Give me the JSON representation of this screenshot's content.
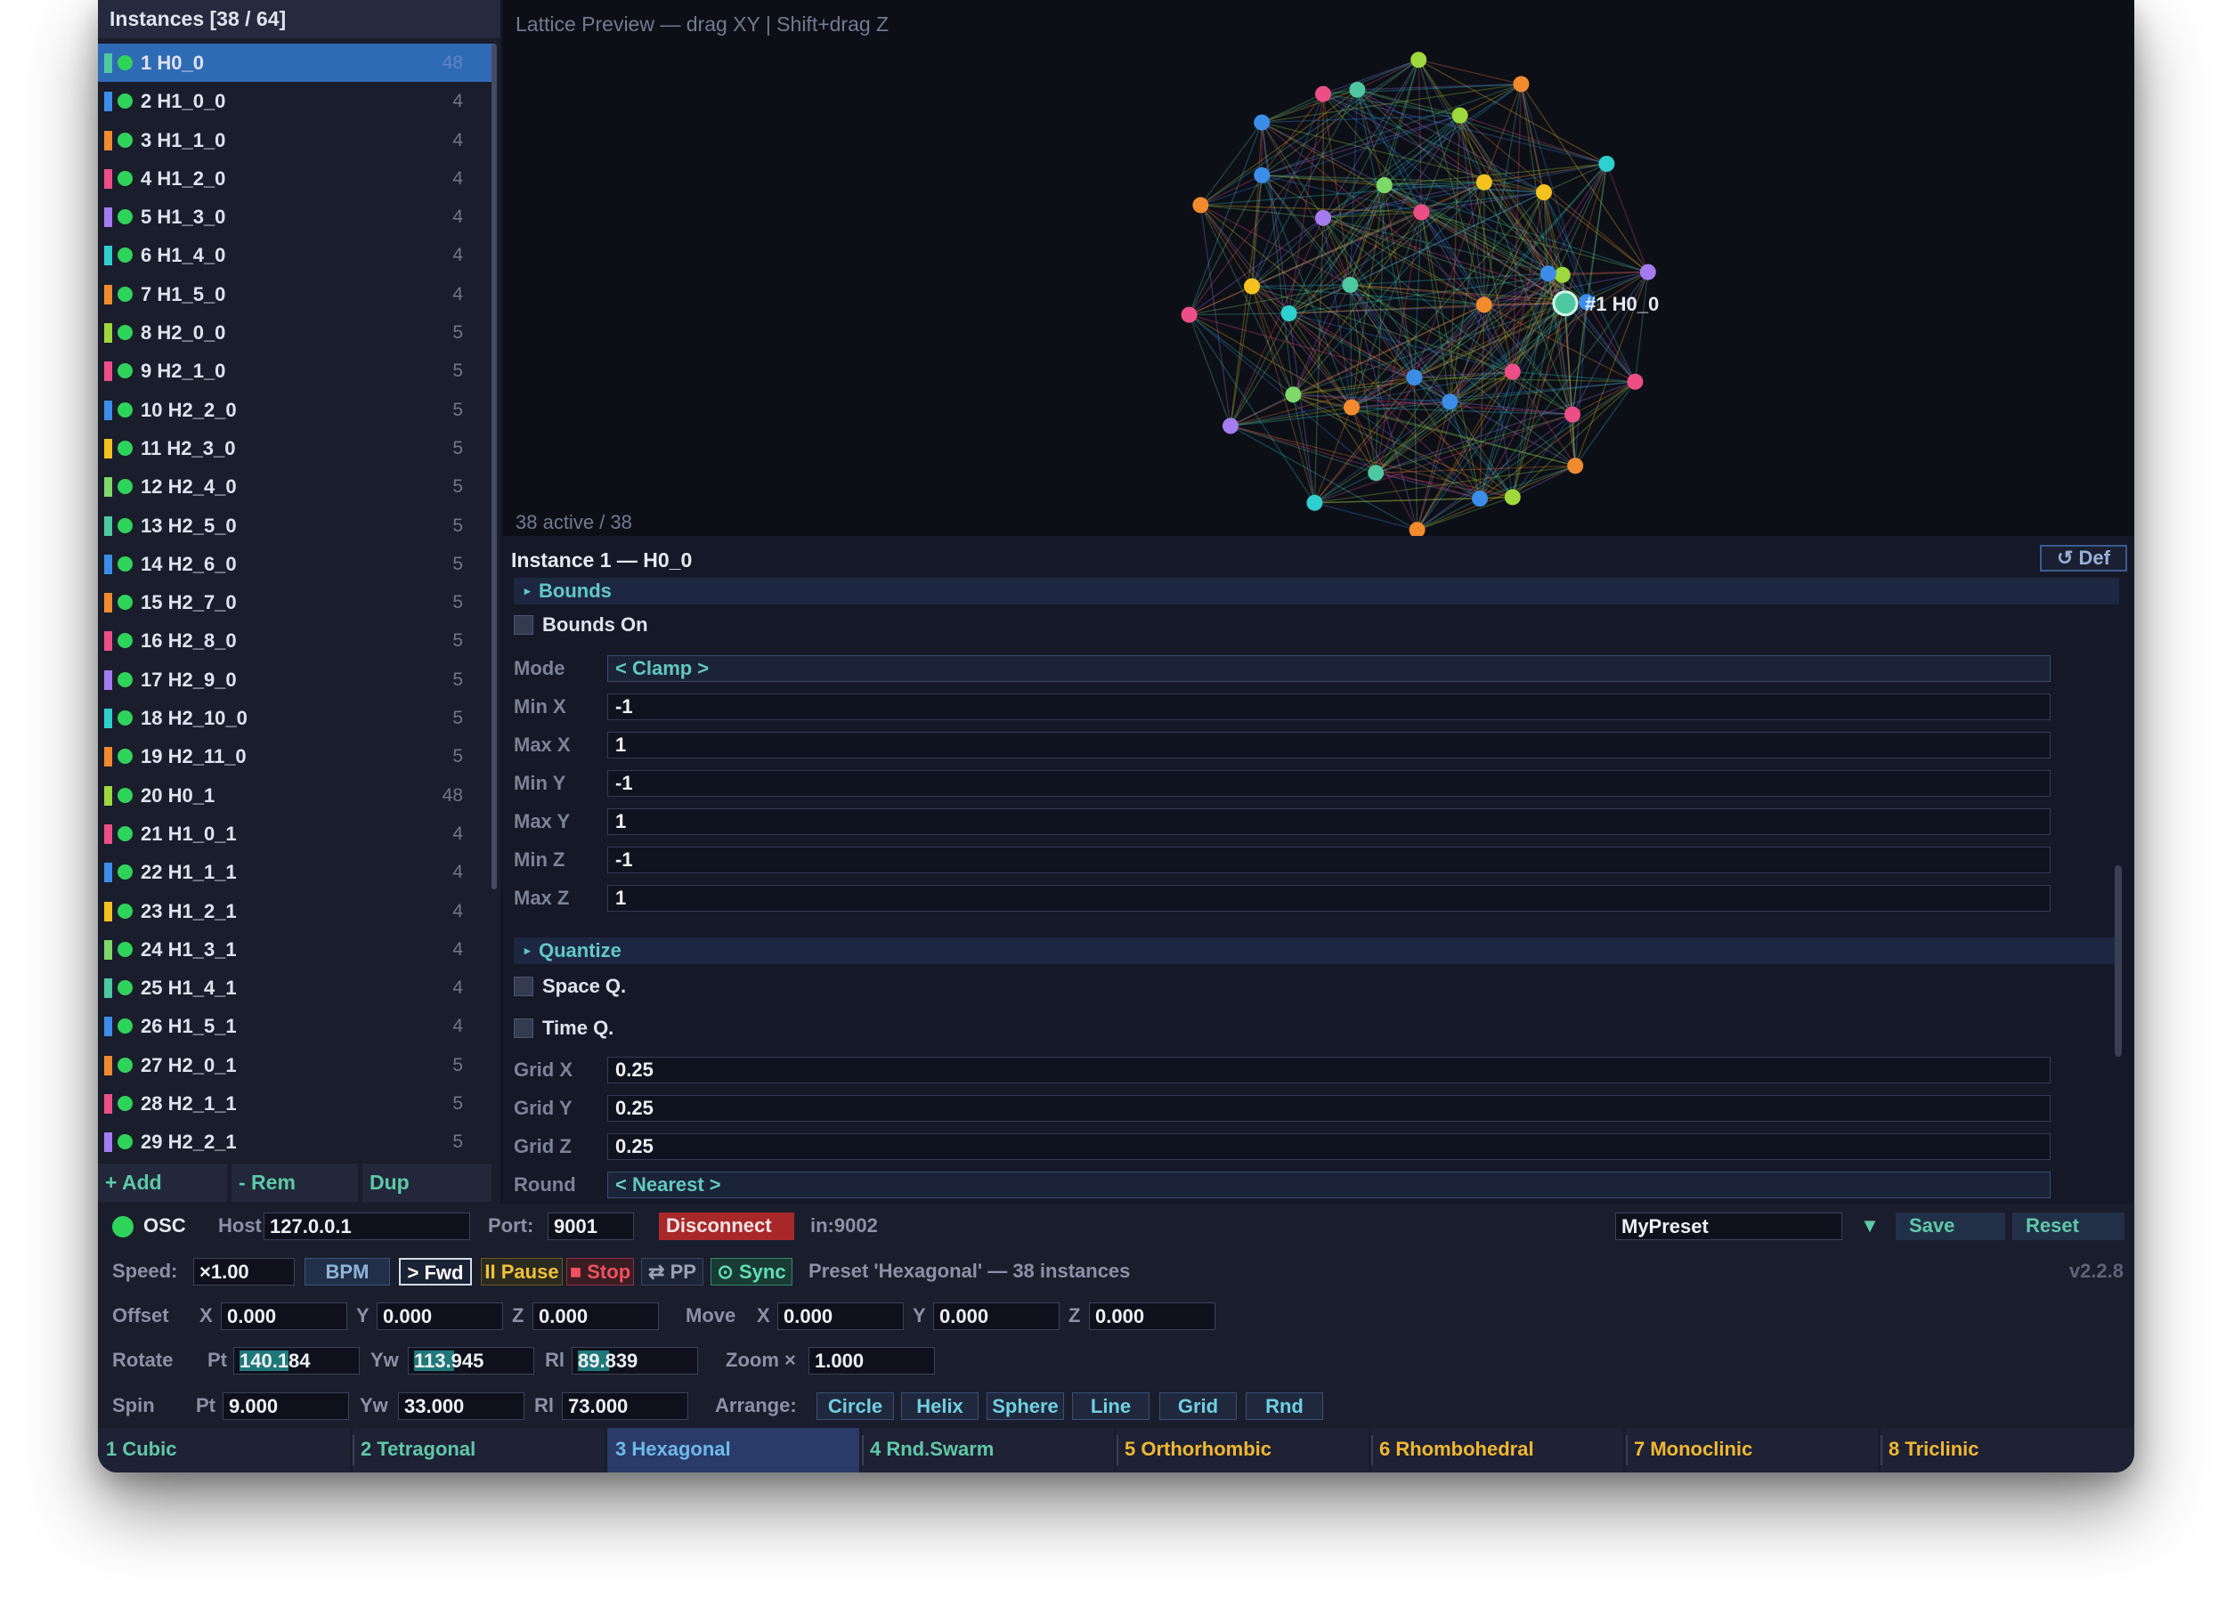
{
  "sidebar": {
    "header": "Instances  [38 / 64]",
    "items": [
      {
        "label": "1  H0_0",
        "count": "48",
        "color": "#4ec8a0"
      },
      {
        "label": "2  H1_0_0",
        "count": "4",
        "color": "#3b8de8"
      },
      {
        "label": "3  H1_1_0",
        "count": "4",
        "color": "#f28a2e"
      },
      {
        "label": "4  H1_2_0",
        "count": "4",
        "color": "#ee4e86"
      },
      {
        "label": "5  H1_3_0",
        "count": "4",
        "color": "#a37cf0"
      },
      {
        "label": "6  H1_4_0",
        "count": "4",
        "color": "#2fcfd0"
      },
      {
        "label": "7  H1_5_0",
        "count": "4",
        "color": "#f28a2e"
      },
      {
        "label": "8  H2_0_0",
        "count": "5",
        "color": "#9ed83c"
      },
      {
        "label": "9  H2_1_0",
        "count": "5",
        "color": "#ee4e86"
      },
      {
        "label": "10  H2_2_0",
        "count": "5",
        "color": "#3b8de8"
      },
      {
        "label": "11  H2_3_0",
        "count": "5",
        "color": "#f4c21f"
      },
      {
        "label": "12  H2_4_0",
        "count": "5",
        "color": "#7ed86a"
      },
      {
        "label": "13  H2_5_0",
        "count": "5",
        "color": "#4ec8a0"
      },
      {
        "label": "14  H2_6_0",
        "count": "5",
        "color": "#3b8de8"
      },
      {
        "label": "15  H2_7_0",
        "count": "5",
        "color": "#f28a2e"
      },
      {
        "label": "16  H2_8_0",
        "count": "5",
        "color": "#ee4e86"
      },
      {
        "label": "17  H2_9_0",
        "count": "5",
        "color": "#a37cf0"
      },
      {
        "label": "18  H2_10_0",
        "count": "5",
        "color": "#2fcfd0"
      },
      {
        "label": "19  H2_11_0",
        "count": "5",
        "color": "#f28a2e"
      },
      {
        "label": "20  H0_1",
        "count": "48",
        "color": "#9ed83c"
      },
      {
        "label": "21  H1_0_1",
        "count": "4",
        "color": "#ee4e86"
      },
      {
        "label": "22  H1_1_1",
        "count": "4",
        "color": "#3b8de8"
      },
      {
        "label": "23  H1_2_1",
        "count": "4",
        "color": "#f4c21f"
      },
      {
        "label": "24  H1_3_1",
        "count": "4",
        "color": "#7ed86a"
      },
      {
        "label": "25  H1_4_1",
        "count": "4",
        "color": "#4ec8a0"
      },
      {
        "label": "26  H1_5_1",
        "count": "4",
        "color": "#3b8de8"
      },
      {
        "label": "27  H2_0_1",
        "count": "5",
        "color": "#f28a2e"
      },
      {
        "label": "28  H2_1_1",
        "count": "5",
        "color": "#ee4e86"
      },
      {
        "label": "29  H2_2_1",
        "count": "5",
        "color": "#a37cf0"
      }
    ],
    "add_label": "+ Add",
    "remove_label": "- Rem",
    "dup_label": "Dup"
  },
  "viewport": {
    "title": "Lattice Preview — drag XY  |  Shift+drag Z",
    "status": "38 active / 38",
    "selected_label": "#1 H0_0"
  },
  "inspector": {
    "title": "Instance 1 — H0_0",
    "default_button": "↺ Def",
    "bounds_section": "Bounds",
    "bounds_on_label": "Bounds On",
    "mode_label": "Mode",
    "mode_value": "< Clamp >",
    "min_x_label": "Min X",
    "min_x": "-1",
    "max_x_label": "Max X",
    "max_x": "1",
    "min_y_label": "Min Y",
    "min_y": "-1",
    "max_y_label": "Max Y",
    "max_y": "1",
    "min_z_label": "Min Z",
    "min_z": "-1",
    "max_z_label": "Max Z",
    "max_z": "1",
    "quantize_section": "Quantize",
    "space_q_label": "Space Q.",
    "time_q_label": "Time  Q.",
    "grid_x_label": "Grid X",
    "grid_x": "0.25",
    "grid_y_label": "Grid Y",
    "grid_y": "0.25",
    "grid_z_label": "Grid Z",
    "grid_z": "0.25",
    "round_label": "Round",
    "round_value": "< Nearest >"
  },
  "osc": {
    "label": "OSC",
    "host_label": "Host:",
    "host": "127.0.0.1",
    "port_label": "Port:",
    "port": "9001",
    "disconnect": "Disconnect",
    "in_port": "in:9002",
    "preset_name": "MyPreset",
    "dropdown": "▼",
    "save": "Save",
    "reset": "Reset"
  },
  "transport": {
    "speed_label": "Speed:",
    "speed": "×1.00",
    "bpm": "BPM",
    "fwd": "> Fwd",
    "pause": "II Pause",
    "stop": "■ Stop",
    "pp": "⇄ PP",
    "sync": "⊙ Sync",
    "preset_status": "Preset 'Hexagonal' — 38 instances",
    "version": "v2.2.8"
  },
  "offset": {
    "label": "Offset",
    "x_label": "X",
    "x": "0.000",
    "y_label": "Y",
    "y": "0.000",
    "z_label": "Z",
    "z": "0.000",
    "move_label": "Move",
    "mx_label": "X",
    "mx": "0.000",
    "my_label": "Y",
    "my": "0.000",
    "mz_label": "Z",
    "mz": "0.000"
  },
  "rotate": {
    "label": "Rotate",
    "pt_label": "Pt",
    "pt": "140.184",
    "pt_level": 0.39,
    "yw_label": "Yw",
    "yw": "113.945",
    "yw_level": 0.32,
    "rl_label": "Rl",
    "rl": "89.839",
    "rl_level": 0.25,
    "zoom_label": "Zoom ×",
    "zoom": "1.000"
  },
  "spin": {
    "label": "Spin",
    "pt_label": "Pt",
    "pt": "9.000",
    "yw_label": "Yw",
    "yw": "33.000",
    "rl_label": "Rl",
    "rl": "73.000",
    "arrange_label": "Arrange:",
    "arrange": [
      "Circle",
      "Helix",
      "Sphere",
      "Line",
      "Grid",
      "Rnd"
    ]
  },
  "presets": [
    "1 Cubic",
    "2 Tetragonal",
    "3 Hexagonal",
    "4 Rnd.Swarm",
    "5 Orthorhombic",
    "6 Rhombohedral",
    "7 Monoclinic",
    "8 Triclinic"
  ],
  "colors": {
    "window_bg": "#131522",
    "selection": "#2f6ab5",
    "accent_teal": "#5fc8a8",
    "active_dot": "#2ed45a",
    "disconnect_bg": "#a8282a",
    "preset_gold": "#f0b830"
  }
}
